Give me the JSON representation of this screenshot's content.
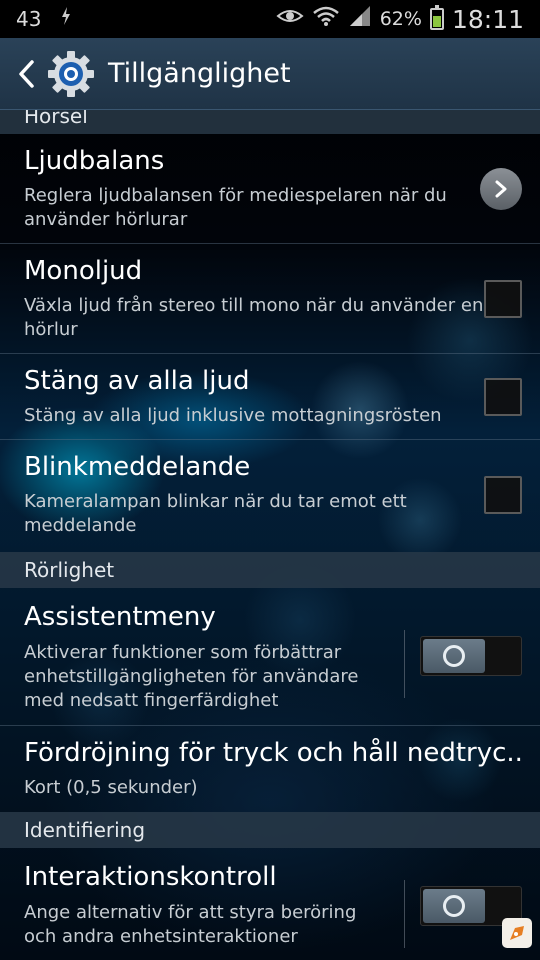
{
  "status_bar": {
    "notification_count": "43",
    "battery_percent": "62%",
    "time": "18:11",
    "icons": [
      "notification-icon",
      "usb-icon",
      "eye-icon",
      "wifi-icon",
      "signal-icon",
      "battery-icon"
    ]
  },
  "action_bar": {
    "title": "Tillgänglighet",
    "icon": "settings-gear-icon"
  },
  "sections": {
    "horsel": "Hörsel",
    "rorlighet": "Rörlighet",
    "identifiering": "Identifiering"
  },
  "items": {
    "ljudbalans": {
      "title": "Ljudbalans",
      "summary": "Reglera ljudbalansen för mediespelaren när du använder hörlurar"
    },
    "monoljud": {
      "title": "Monoljud",
      "summary": "Växla ljud från stereo till mono när du använder en hörlur",
      "checked": false
    },
    "stang_av": {
      "title": "Stäng av alla ljud",
      "summary": "Stäng av alla ljud inklusive mottagningsrösten",
      "checked": false
    },
    "blink": {
      "title": "Blinkmeddelande",
      "summary": "Kameralampan blinkar när du tar emot ett meddelande",
      "checked": false
    },
    "assistent": {
      "title": "Assistentmeny",
      "summary": "Aktiverar funktioner som förbättrar enhetstillgängligheten för användare med nedsatt fingerfärdighet",
      "enabled": false
    },
    "fordrojning": {
      "title": "Fördröjning för tryck och håll nedtryc..",
      "summary": "Kort (0,5 sekunder)"
    },
    "interaktion": {
      "title": "Interaktionskontroll",
      "summary": "Ange alternativ för att styra beröring och andra enhetsinteraktioner",
      "enabled": false
    }
  },
  "colors": {
    "action_bar": "#2a4258",
    "section_header": "#283848",
    "battery": "#8cc63f"
  }
}
